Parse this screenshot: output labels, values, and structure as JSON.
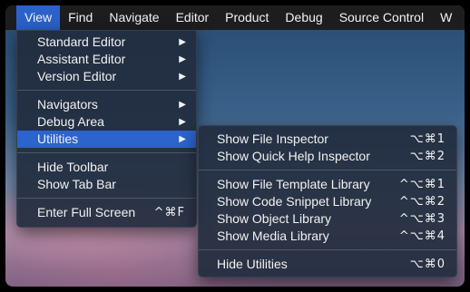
{
  "menubar": {
    "items": [
      "View",
      "Find",
      "Navigate",
      "Editor",
      "Product",
      "Debug",
      "Source Control",
      "W"
    ]
  },
  "view_menu": {
    "items": [
      {
        "label": "Standard Editor",
        "arrow": "▶"
      },
      {
        "label": "Assistant Editor",
        "arrow": "▶"
      },
      {
        "label": "Version Editor",
        "arrow": "▶"
      },
      {
        "label": "Navigators",
        "arrow": "▶"
      },
      {
        "label": "Debug Area",
        "arrow": "▶"
      },
      {
        "label": "Utilities",
        "arrow": "▶"
      },
      {
        "label": "Hide Toolbar"
      },
      {
        "label": "Show Tab Bar"
      },
      {
        "label": "Enter Full Screen",
        "shortcut": "^⌘F"
      }
    ]
  },
  "utilities_menu": {
    "items": [
      {
        "label": "Show File Inspector",
        "shortcut": "⌥⌘1"
      },
      {
        "label": "Show Quick Help Inspector",
        "shortcut": "⌥⌘2"
      },
      {
        "label": "Show File Template Library",
        "shortcut": "^⌥⌘1"
      },
      {
        "label": "Show Code Snippet Library",
        "shortcut": "^⌥⌘2"
      },
      {
        "label": "Show Object Library",
        "shortcut": "^⌥⌘3"
      },
      {
        "label": "Show Media Library",
        "shortcut": "^⌥⌘4"
      },
      {
        "label": "Hide Utilities",
        "shortcut": "⌥⌘0"
      }
    ]
  },
  "colors": {
    "menubar": "#1d1d1f",
    "highlight": "#2c63cc",
    "menu_bg": "#222d3e"
  }
}
